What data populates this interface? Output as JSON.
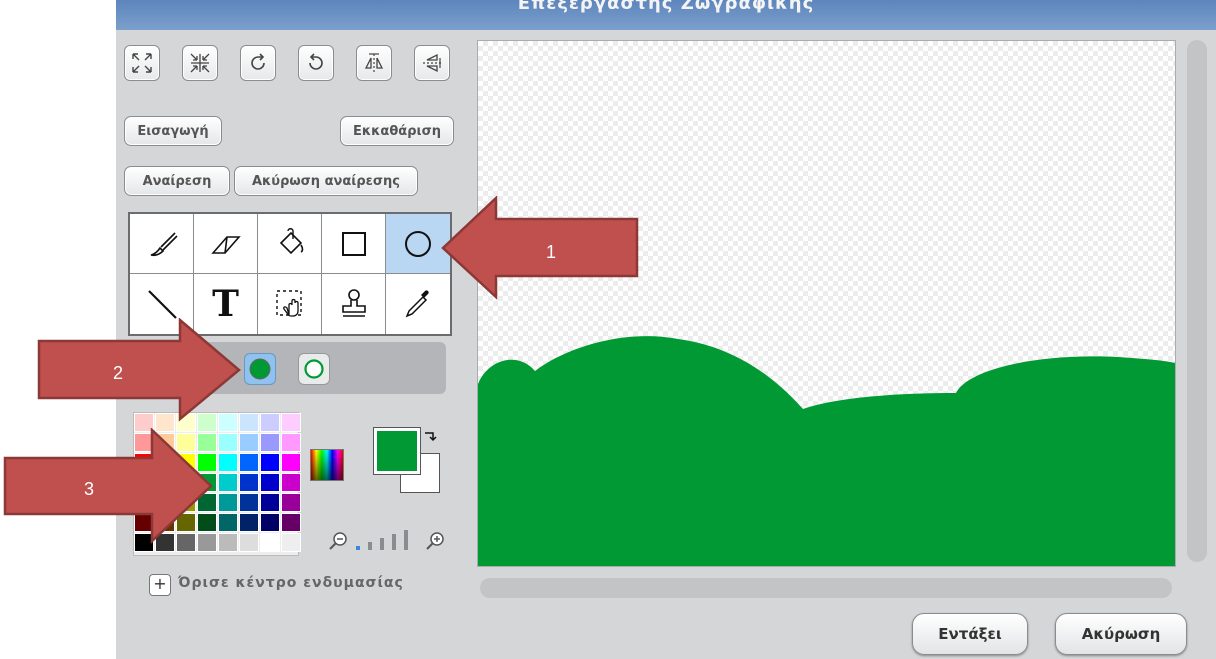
{
  "window": {
    "title": "Επεξεργαστής Ζωγραφικής"
  },
  "toolbar": {
    "icons": [
      "expand-icon",
      "shrink-icon",
      "rotate-left-icon",
      "rotate-right-icon",
      "flip-horizontal-icon",
      "flip-vertical-icon"
    ]
  },
  "buttons": {
    "import": "Εισαγωγή",
    "clear": "Εκκαθάριση",
    "undo": "Αναίρεση",
    "redo": "Ακύρωση αναίρεσης"
  },
  "tools": {
    "items": [
      "paintbrush-icon",
      "eraser-icon",
      "fill-bucket-icon",
      "rectangle-icon",
      "ellipse-icon",
      "line-icon",
      "text-icon",
      "select-icon",
      "stamp-icon",
      "eyedropper-icon"
    ],
    "text_glyph": "T",
    "selected": "ellipse-icon"
  },
  "shape_options": {
    "filled": true,
    "outline": false
  },
  "palette": {
    "rows": [
      [
        "#ffcccc",
        "#ffe5cc",
        "#ffffcc",
        "#ccffcc",
        "#ccffff",
        "#cce5ff",
        "#ccccff",
        "#ffccff"
      ],
      [
        "#ff9999",
        "#ffcc99",
        "#ffff99",
        "#99ff99",
        "#99ffff",
        "#99ccff",
        "#9999ff",
        "#ff99ff"
      ],
      [
        "#ff0000",
        "#ff9900",
        "#ffff00",
        "#00ff00",
        "#00ffff",
        "#0066ff",
        "#0000ff",
        "#ff00ff"
      ],
      [
        "#cc0000",
        "#cc6600",
        "#cccc00",
        "#009933",
        "#00cccc",
        "#0033cc",
        "#0000cc",
        "#cc00cc"
      ],
      [
        "#990000",
        "#994c00",
        "#999900",
        "#006633",
        "#009999",
        "#003399",
        "#000099",
        "#990099"
      ],
      [
        "#660000",
        "#663300",
        "#666600",
        "#004d1a",
        "#006666",
        "#002266",
        "#000066",
        "#660066"
      ],
      [
        "#000000",
        "#333333",
        "#666666",
        "#999999",
        "#bbbbbb",
        "#dddddd",
        "#ffffff",
        "#eeeeee"
      ]
    ]
  },
  "colors": {
    "primary": "#009933",
    "secondary": "#ffffff",
    "accent": "#b9d6f3"
  },
  "zoom": {
    "level": 1,
    "max": 4
  },
  "set_center": {
    "label": "Όρισε κέντρο ενδυμασίας"
  },
  "dialog": {
    "ok": "Εντάξει",
    "cancel": "Ακύρωση"
  },
  "annotations": [
    {
      "label": "1"
    },
    {
      "label": "2"
    },
    {
      "label": "3"
    }
  ]
}
